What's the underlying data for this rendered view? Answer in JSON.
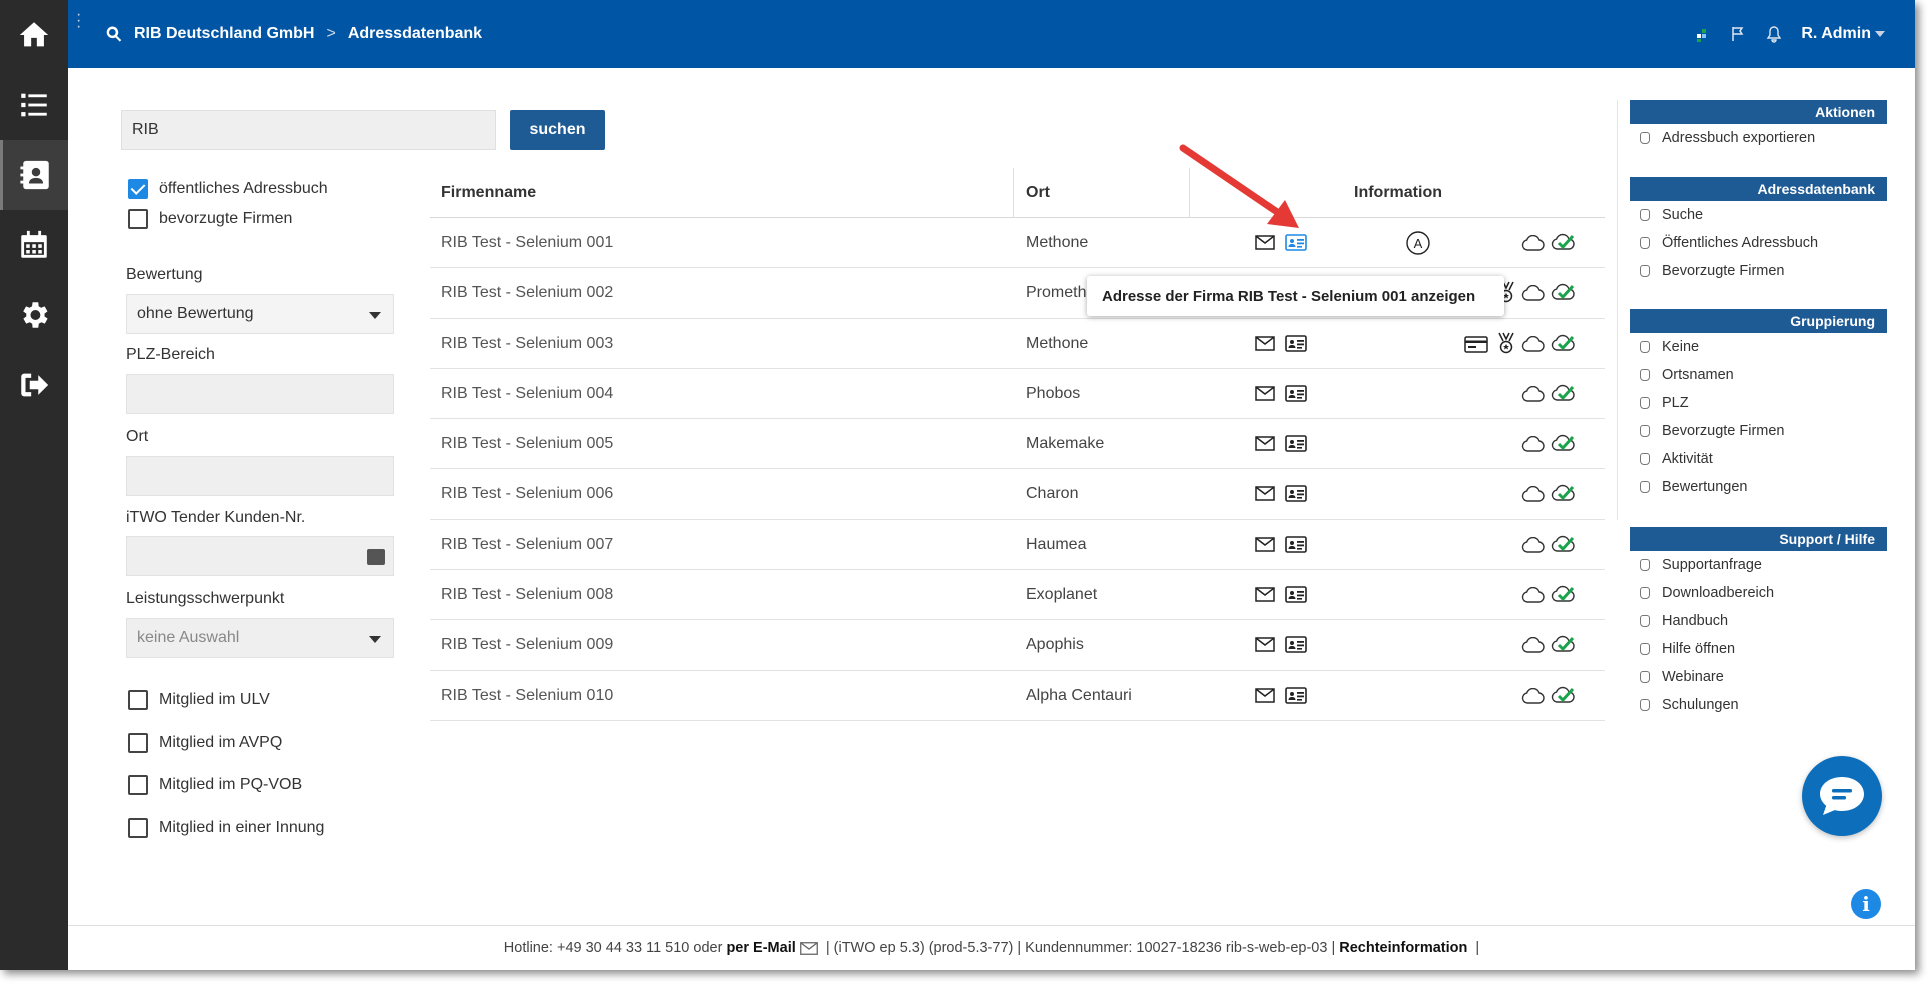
{
  "header": {
    "company": "RIB Deutschland GmbH",
    "separator": ">",
    "page": "Adressdatenbank",
    "user": "R. Admin"
  },
  "search": {
    "value": "RIB",
    "button": "suchen"
  },
  "filters": {
    "public_addressbook": {
      "label": "öffentliches Adressbuch",
      "checked": true
    },
    "preferred_firms": {
      "label": "bevorzugte Firmen",
      "checked": false
    },
    "rating_label": "Bewertung",
    "rating_value": "ohne Bewertung",
    "zip_label": "PLZ-Bereich",
    "city_label": "Ort",
    "customer_no_label": "iTWO Tender Kunden-Nr.",
    "focus_label": "Leistungsschwerpunkt",
    "focus_value": "keine Auswahl",
    "memberships": [
      {
        "label": "Mitglied im ULV",
        "checked": false
      },
      {
        "label": "Mitglied im AVPQ",
        "checked": false
      },
      {
        "label": "Mitglied im PQ-VOB",
        "checked": false
      },
      {
        "label": "Mitglied in einer Innung",
        "checked": false
      }
    ]
  },
  "table": {
    "columns": [
      "Firmenname",
      "Ort",
      "Information"
    ],
    "rows": [
      {
        "name": "RIB Test - Selenium 001",
        "city": "Methone",
        "badge_a": true,
        "card": false,
        "medal": false
      },
      {
        "name": "RIB Test - Selenium 002",
        "city": "Prometh",
        "badge_a": false,
        "card": false,
        "medal": true
      },
      {
        "name": "RIB Test - Selenium 003",
        "city": "Methone",
        "badge_a": false,
        "card": true,
        "medal": true
      },
      {
        "name": "RIB Test - Selenium 004",
        "city": "Phobos",
        "badge_a": false,
        "card": false,
        "medal": false
      },
      {
        "name": "RIB Test - Selenium 005",
        "city": "Makemake",
        "badge_a": false,
        "card": false,
        "medal": false
      },
      {
        "name": "RIB Test - Selenium 006",
        "city": "Charon",
        "badge_a": false,
        "card": false,
        "medal": false
      },
      {
        "name": "RIB Test - Selenium 007",
        "city": "Haumea",
        "badge_a": false,
        "card": false,
        "medal": false
      },
      {
        "name": "RIB Test - Selenium 008",
        "city": "Exoplanet",
        "badge_a": false,
        "card": false,
        "medal": false
      },
      {
        "name": "RIB Test - Selenium 009",
        "city": "Apophis",
        "badge_a": false,
        "card": false,
        "medal": false
      },
      {
        "name": "RIB Test - Selenium 010",
        "city": "Alpha Centauri",
        "badge_a": false,
        "card": false,
        "medal": false
      }
    ]
  },
  "tooltip": "Adresse der Firma RIB Test - Selenium 001 anzeigen",
  "side": {
    "aktionen": {
      "title": "Aktionen",
      "items": [
        "Adressbuch exportieren"
      ]
    },
    "adressdatenbank": {
      "title": "Adressdatenbank",
      "items": [
        "Suche",
        "Öffentliches Adressbuch",
        "Bevorzugte Firmen"
      ]
    },
    "gruppierung": {
      "title": "Gruppierung",
      "items": [
        "Keine",
        "Ortsnamen",
        "PLZ",
        "Bevorzugte Firmen",
        "Aktivität",
        "Bewertungen"
      ]
    },
    "support": {
      "title": "Support / Hilfe",
      "items": [
        "Supportanfrage",
        "Downloadbereich",
        "Handbuch",
        "Hilfe öffnen",
        "Webinare",
        "Schulungen"
      ]
    }
  },
  "footer": {
    "hotline": "Hotline: +49 30 44 33 11 510 oder",
    "email": "per E-Mail",
    "version": "|  (iTWO ep 5.3) (prod-5.3-77)  |  Kundennummer: 10027-18236 rib-s-web-ep-03 |",
    "legal": "Rechteinformation",
    "tail": "|"
  },
  "colors": {
    "topbar": "#0055a4",
    "rail": "#2b2b2b",
    "accent": "#1e5a93",
    "check_green": "#1aa34a"
  },
  "icons": {
    "rail": [
      "home-icon",
      "list-icon",
      "contacts-icon",
      "calendar-icon",
      "gear-icon",
      "logout-icon"
    ],
    "row": [
      "mail-icon",
      "address-card-icon",
      "cloud-icon",
      "cloud-check-icon"
    ]
  }
}
